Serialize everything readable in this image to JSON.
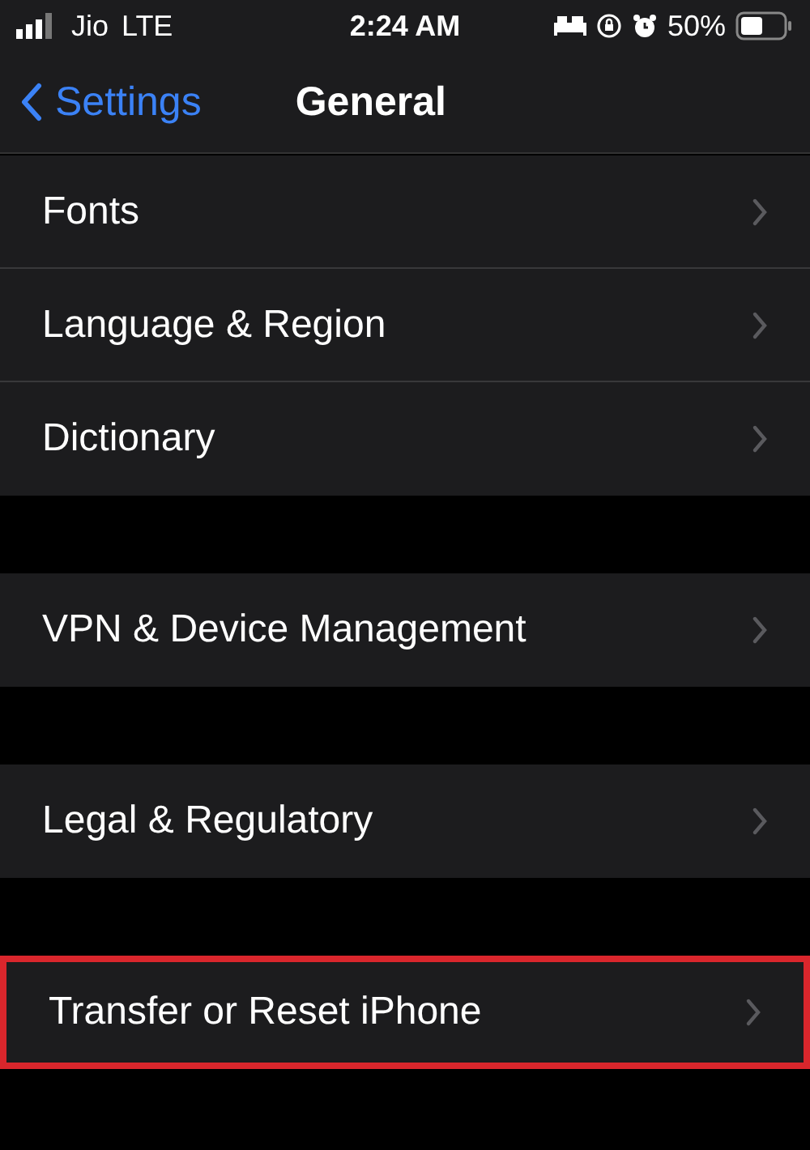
{
  "status_bar": {
    "carrier": "Jio",
    "network": "LTE",
    "time": "2:24 AM",
    "battery": "50%"
  },
  "nav": {
    "back": "Settings",
    "title": "General"
  },
  "sections": [
    {
      "items": [
        {
          "label": "Fonts",
          "highlighted": false
        },
        {
          "label": "Language & Region",
          "highlighted": false
        },
        {
          "label": "Dictionary",
          "highlighted": false
        }
      ]
    },
    {
      "items": [
        {
          "label": "VPN & Device Management",
          "highlighted": false
        }
      ]
    },
    {
      "items": [
        {
          "label": "Legal & Regulatory",
          "highlighted": false
        }
      ]
    },
    {
      "items": [
        {
          "label": "Transfer or Reset iPhone",
          "highlighted": true
        }
      ]
    }
  ]
}
